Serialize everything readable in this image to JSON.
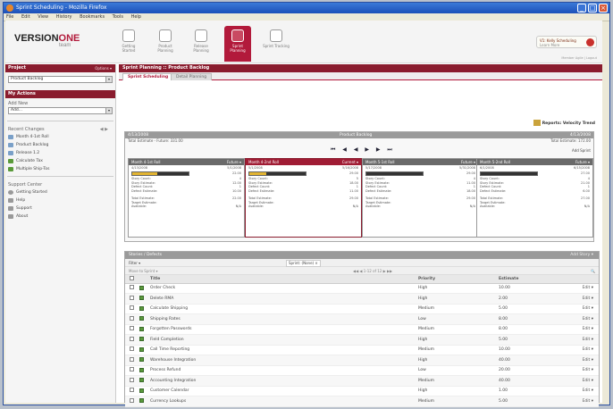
{
  "window": {
    "title": "Sprint Scheduling - Mozilla Firefox"
  },
  "menu": [
    "File",
    "Edit",
    "View",
    "History",
    "Bookmarks",
    "Tools",
    "Help"
  ],
  "logo": {
    "name": "VERSION",
    "one": "ONE",
    "team": "team"
  },
  "nav": [
    {
      "label": "Getting Started"
    },
    {
      "label": "Product Planning"
    },
    {
      "label": "Release Planning"
    },
    {
      "label": "Sprint Planning"
    },
    {
      "label": "Sprint Tracking"
    }
  ],
  "user": {
    "line1": "V1: Kelly Scheduling",
    "line2": "Learn More"
  },
  "member_info": "Member Agile | Logout",
  "left": {
    "project_head": "Project",
    "project_opt": "Options ▾",
    "project_value": "Product Backlog",
    "myactions_head": "My Actions",
    "addnew": "Add New",
    "addnew_value": "Add...",
    "recent_head": "Recent Changes",
    "recent_items": [
      "Month 4-1st Roll",
      "Product Backlog",
      "Release 1.2",
      "Calculate Tax",
      "Multiple Ship-Tos"
    ],
    "support_head": "Support Center",
    "support_items": [
      "Getting Started",
      "Help",
      "Support",
      "About"
    ]
  },
  "main": {
    "title": "Sprint Planning :: Product Backlog",
    "tabs": [
      "Sprint Scheduling",
      "Detail Planning"
    ],
    "reports": "Reports: Velocity Trend",
    "plan": {
      "date_left": "4/13/2008",
      "center": "Product Backlog",
      "date_right": "4/13/2008",
      "estimate_left": "Total Estimate - Future: 331.00",
      "estimate_right": "Total Estimate: 172.00",
      "nav": "⏮ ◀ ◀ ▶ ▶ ⏭",
      "add_sprint": "Add Sprint"
    },
    "cards": [
      {
        "title": "Month 4-1st Roll",
        "status": "Future ▾",
        "start": "4/13/2008",
        "end": "5/1/2008",
        "prog": "22.00",
        "fill": 0.45,
        "rows": [
          [
            "Story Count:",
            "4"
          ],
          [
            "Story Estimate:",
            "12.00"
          ],
          [
            "Defect Count:",
            "1"
          ],
          [
            "Defect Estimate:",
            "10.00"
          ],
          [
            "Total Estimate:",
            "22.00"
          ],
          [
            "Target Estimate:",
            ""
          ],
          [
            "Available:",
            "N/A"
          ]
        ]
      },
      {
        "title": "Month 4-2nd Roll",
        "status": "Current ▾",
        "start": "5/1/2008",
        "end": "5/16/2008",
        "prog": "29.00",
        "fill": 0.3,
        "rows": [
          [
            "Story Count:",
            "5"
          ],
          [
            "Story Estimate:",
            "18.00"
          ],
          [
            "Defect Count:",
            "1"
          ],
          [
            "Defect Estimate:",
            "11.00"
          ],
          [
            "Total Estimate:",
            "29.00"
          ],
          [
            "Target Estimate:",
            ""
          ],
          [
            "Available:",
            "N/A"
          ]
        ]
      },
      {
        "title": "Month 5-1st Roll",
        "status": "Future ▾",
        "start": "5/17/2008",
        "end": "5/31/2008",
        "prog": "29.00",
        "fill": 0.0,
        "rows": [
          [
            "Story Count:",
            "4"
          ],
          [
            "Story Estimate:",
            "11.00"
          ],
          [
            "Defect Count:",
            "1"
          ],
          [
            "Defect Estimate:",
            "18.00"
          ],
          [
            "Total Estimate:",
            "29.00"
          ],
          [
            "Target Estimate:",
            ""
          ],
          [
            "Available:",
            "N/A"
          ]
        ]
      },
      {
        "title": "Month 5-2nd Roll",
        "status": "Future ▾",
        "start": "6/1/2008",
        "end": "6/15/2008",
        "prog": "27.00",
        "fill": 0.0,
        "rows": [
          [
            "Story Count:",
            "4"
          ],
          [
            "Story Estimate:",
            "21.00"
          ],
          [
            "Defect Count:",
            "1"
          ],
          [
            "Defect Estimate:",
            "6.00"
          ],
          [
            "Total Estimate:",
            "27.00"
          ],
          [
            "Target Estimate:",
            ""
          ],
          [
            "Available:",
            "N/A"
          ]
        ]
      }
    ],
    "stories": {
      "head": "Stories / Defects",
      "add": "Add Story ▾",
      "filter": "Filter ▾",
      "sprint_filter": "Sprint: (None) ×",
      "move": "Move to Sprint ▾",
      "paging": "◀◀ ◀ 1-12 of 12 ▶ ▶▶",
      "columns": [
        "Title",
        "Priority",
        "Estimate"
      ],
      "edit": "Edit",
      "rows": [
        {
          "title": "Order Check",
          "priority": "High",
          "estimate": "10.00"
        },
        {
          "title": "Delete RMA",
          "priority": "High",
          "estimate": "2.00"
        },
        {
          "title": "Calculate Shipping",
          "priority": "Medium",
          "estimate": "5.00"
        },
        {
          "title": "Shipping Rates",
          "priority": "Low",
          "estimate": "8.00"
        },
        {
          "title": "Forgotten Passwords",
          "priority": "Medium",
          "estimate": "8.00"
        },
        {
          "title": "Field Completion",
          "priority": "High",
          "estimate": "5.00"
        },
        {
          "title": "Call Time Reporting",
          "priority": "Medium",
          "estimate": "10.00"
        },
        {
          "title": "Warehouse Integration",
          "priority": "High",
          "estimate": "40.00"
        },
        {
          "title": "Process Refund",
          "priority": "Low",
          "estimate": "20.00"
        },
        {
          "title": "Accounting Integration",
          "priority": "Medium",
          "estimate": "40.00"
        },
        {
          "title": "Customer Calendar",
          "priority": "High",
          "estimate": "1.00"
        },
        {
          "title": "Currency Lookups",
          "priority": "Medium",
          "estimate": "5.00"
        }
      ]
    }
  }
}
